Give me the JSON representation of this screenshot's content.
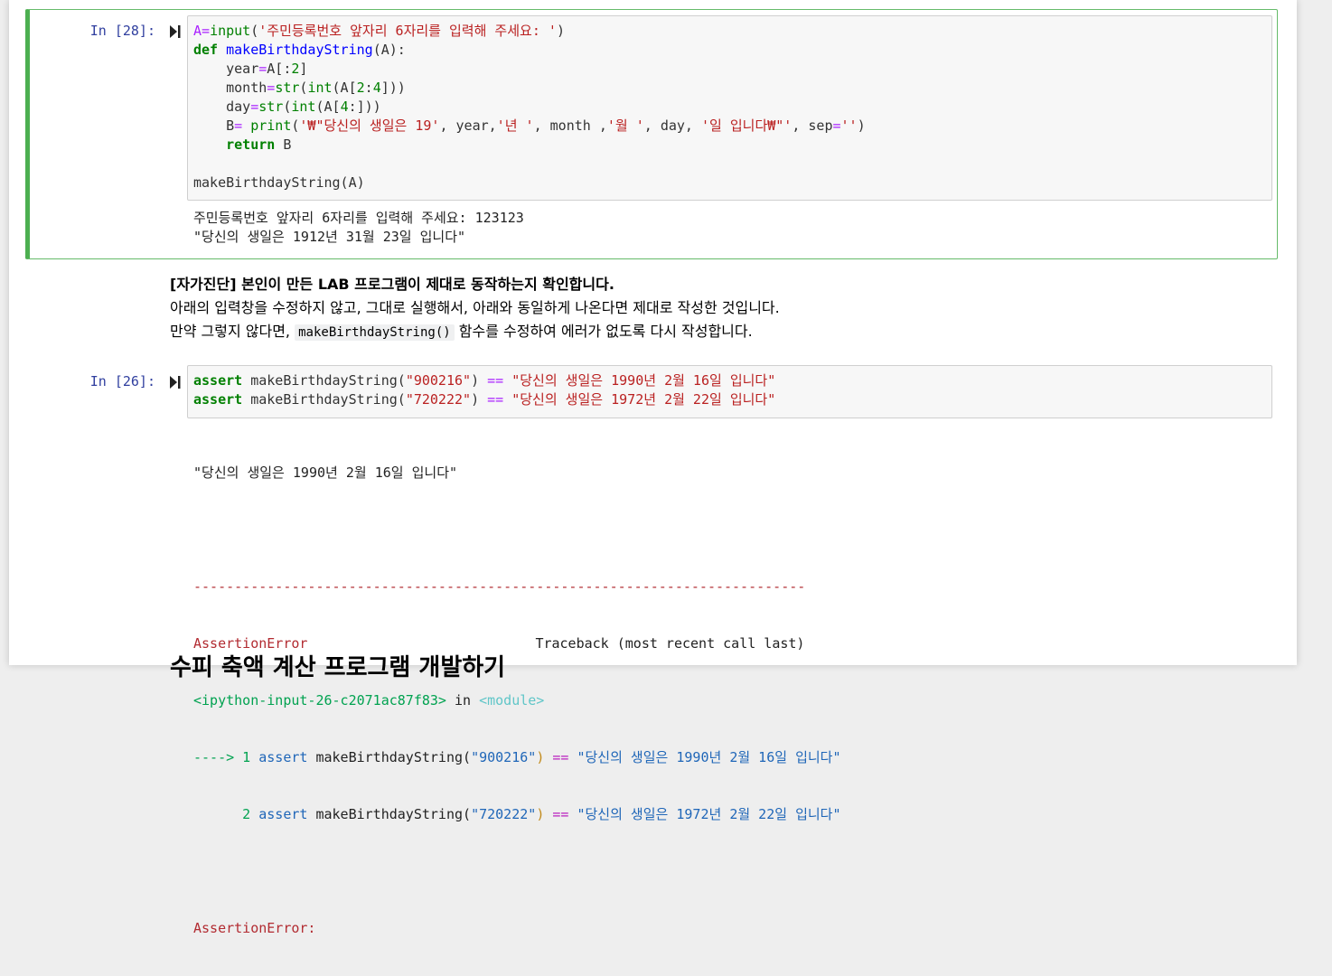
{
  "cells": [
    {
      "prompt": "In [28]:",
      "code_lines": [
        [
          [
            "op",
            "A"
          ],
          [
            "op",
            "="
          ],
          [
            "bi",
            "input"
          ],
          [
            "",
            "("
          ],
          [
            "str",
            "'주민등록번호 앞자리 6자리를 입력해 주세요: '"
          ],
          [
            "",
            ")"
          ]
        ],
        [
          [
            "kw",
            "def "
          ],
          [
            "fn",
            "makeBirthdayString"
          ],
          [
            "",
            "(A):"
          ]
        ],
        [
          [
            "",
            "    year"
          ],
          [
            "op",
            "="
          ],
          [
            "",
            "A[:"
          ],
          [
            "num",
            "2"
          ],
          [
            "",
            "]"
          ]
        ],
        [
          [
            "",
            "    month"
          ],
          [
            "op",
            "="
          ],
          [
            "bi",
            "str"
          ],
          [
            "",
            "("
          ],
          [
            "bi",
            "int"
          ],
          [
            "",
            "(A["
          ],
          [
            "num",
            "2"
          ],
          [
            "",
            ":"
          ],
          [
            "num",
            "4"
          ],
          [
            "",
            "]))"
          ]
        ],
        [
          [
            "",
            "    day"
          ],
          [
            "op",
            "="
          ],
          [
            "bi",
            "str"
          ],
          [
            "",
            "("
          ],
          [
            "bi",
            "int"
          ],
          [
            "",
            "(A["
          ],
          [
            "num",
            "4"
          ],
          [
            "",
            ":]))"
          ]
        ],
        [
          [
            "",
            "    B"
          ],
          [
            "op",
            "= "
          ],
          [
            "bi",
            "print"
          ],
          [
            "",
            "("
          ],
          [
            "str",
            "'₩\"당신의 생일은 19'"
          ],
          [
            "",
            ", year,"
          ],
          [
            "str",
            "'년 '"
          ],
          [
            "",
            ", month ,"
          ],
          [
            "str",
            "'월 '"
          ],
          [
            "",
            ", day, "
          ],
          [
            "str",
            "'일 입니다₩\"'"
          ],
          [
            "",
            ", sep"
          ],
          [
            "op",
            "="
          ],
          [
            "str",
            "''"
          ],
          [
            "",
            ")"
          ]
        ],
        [
          [
            "kw",
            "    return "
          ],
          [
            "",
            "B"
          ]
        ],
        [
          [
            "",
            ""
          ]
        ],
        [
          [
            "",
            "makeBirthdayString(A)"
          ]
        ]
      ],
      "output_lines": [
        "주민등록번호 앞자리 6자리를 입력해 주세요: 123123",
        "\"당신의 생일은 1912년 31월 23일 입니다\""
      ]
    },
    {
      "prompt": "In [26]:",
      "code_lines": [
        [
          [
            "kw",
            "assert "
          ],
          [
            "",
            "makeBirthdayString("
          ],
          [
            "str",
            "\"900216\""
          ],
          [
            "",
            ") "
          ],
          [
            "op",
            "=="
          ],
          [
            "",
            ""
          ],
          [
            "str",
            " \"당신의 생일은 1990년 2월 16일 입니다\""
          ]
        ],
        [
          [
            "kw",
            "assert "
          ],
          [
            "",
            "makeBirthdayString("
          ],
          [
            "str",
            "\"720222\""
          ],
          [
            "",
            ") "
          ],
          [
            "op",
            "=="
          ],
          [
            "",
            ""
          ],
          [
            "str",
            " \"당신의 생일은 1972년 2월 22일 입니다\""
          ]
        ]
      ],
      "output_text": "\"당신의 생일은 1990년 2월 16일 입니다\"",
      "traceback": {
        "separator": "---------------------------------------------------------------------------",
        "error_name": "AssertionError",
        "header_right": "Traceback (most recent call last)",
        "file_ref": "<ipython-input-26-c2071ac87f83>",
        "in_word": " in ",
        "module": "<module>",
        "arrow": "----> 1 ",
        "line2_prefix": "      2 ",
        "assert_kw": "assert",
        "call": " makeBirthdayString(",
        "arg1": "\"900216\"",
        "arg2": "\"720222\"",
        "eq": "==",
        "str1": "\"당신의 생일은 1990년 2월 16일 입니다\"",
        "str2": "\"당신의 생일은 1972년 2월 22일 입니다\"",
        "final_error": "AssertionError:"
      }
    }
  ],
  "markdown": {
    "bold_line": "[자가진단] 본인이 만든 LAB 프로그램이 제대로 동작하는지 확인합니다.",
    "line2": "아래의 입력창을 수정하지 않고, 그대로 실행해서, 아래와 동일하게 나온다면 제대로 작성한 것입니다.",
    "line3_pre": "만약 그렇지 않다면, ",
    "line3_code": "makeBirthdayString()",
    "line3_post": " 함수를 수정하여 에러가 없도록 다시 작성합니다."
  },
  "next_heading": "수피 축액 계산 프로그램 개발하기",
  "colors": {
    "selected_border": "#4caf50",
    "prompt_blue": "#303f9f",
    "keyword_green": "#008000",
    "string_red": "#ba2121",
    "operator_purple": "#aa22ff"
  },
  "icons": [
    "run-cell-icon"
  ]
}
